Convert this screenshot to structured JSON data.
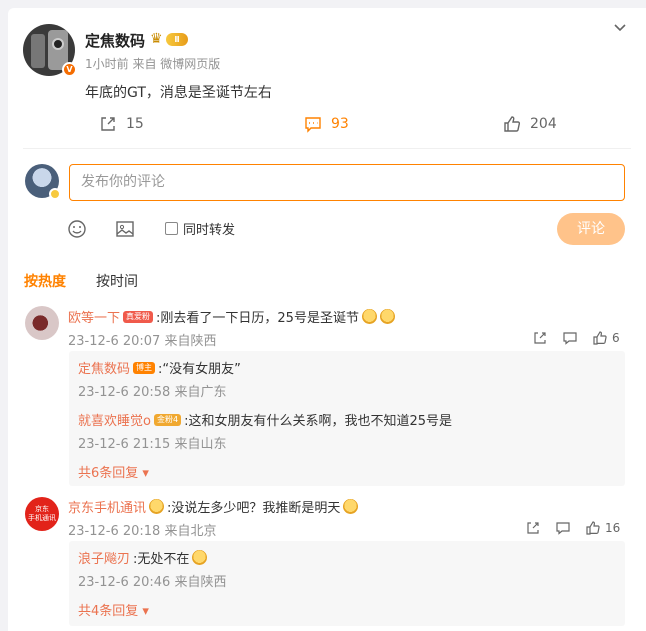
{
  "post": {
    "author": "定焦数码",
    "level_badge": "Ⅱ",
    "verified_badge": "V",
    "meta": "1小时前  来自 微博网页版",
    "text": "年底的GT，消息是圣诞节左右",
    "reposts": "15",
    "comments": "93",
    "likes": "204"
  },
  "composer": {
    "placeholder": "发布你的评论",
    "repost_label": "同时转发",
    "submit_label": "评论"
  },
  "sort_tabs": [
    "按热度",
    "按时间"
  ],
  "comments": [
    {
      "name": "欧等一下",
      "badge": "真爱粉",
      "text": ":刚去看了一下日历，25号是圣诞节",
      "time": "23-12-6 20:07 来自陕西",
      "likes": "6",
      "replies": [
        {
          "name": "定焦数码",
          "badge": "博主",
          "text": ":“没有女朋友”",
          "time": "23-12-6 20:58 来自广东"
        },
        {
          "name": "就喜欢睡觉o",
          "badge": "金粉4",
          "text": ":这和女朋友有什么关系啊，我也不知道25号是",
          "time": "23-12-6 21:15 来自山东"
        }
      ],
      "more_replies": "共6条回复"
    },
    {
      "name": "京东手机通讯",
      "avatar_text": "京东\n手机通讯",
      "text": ":没说左多少吧？我推断是明天",
      "time": "23-12-6 20:18 来自北京",
      "likes": "16",
      "replies": [
        {
          "name": "浪子飚刃",
          "text": ":无处不在",
          "time": "23-12-6 20:46 来自陕西"
        }
      ],
      "more_replies": "共4条回复"
    }
  ],
  "colors": {
    "accent": "#ff8200",
    "name": "#eb7350",
    "muted": "#939393"
  }
}
